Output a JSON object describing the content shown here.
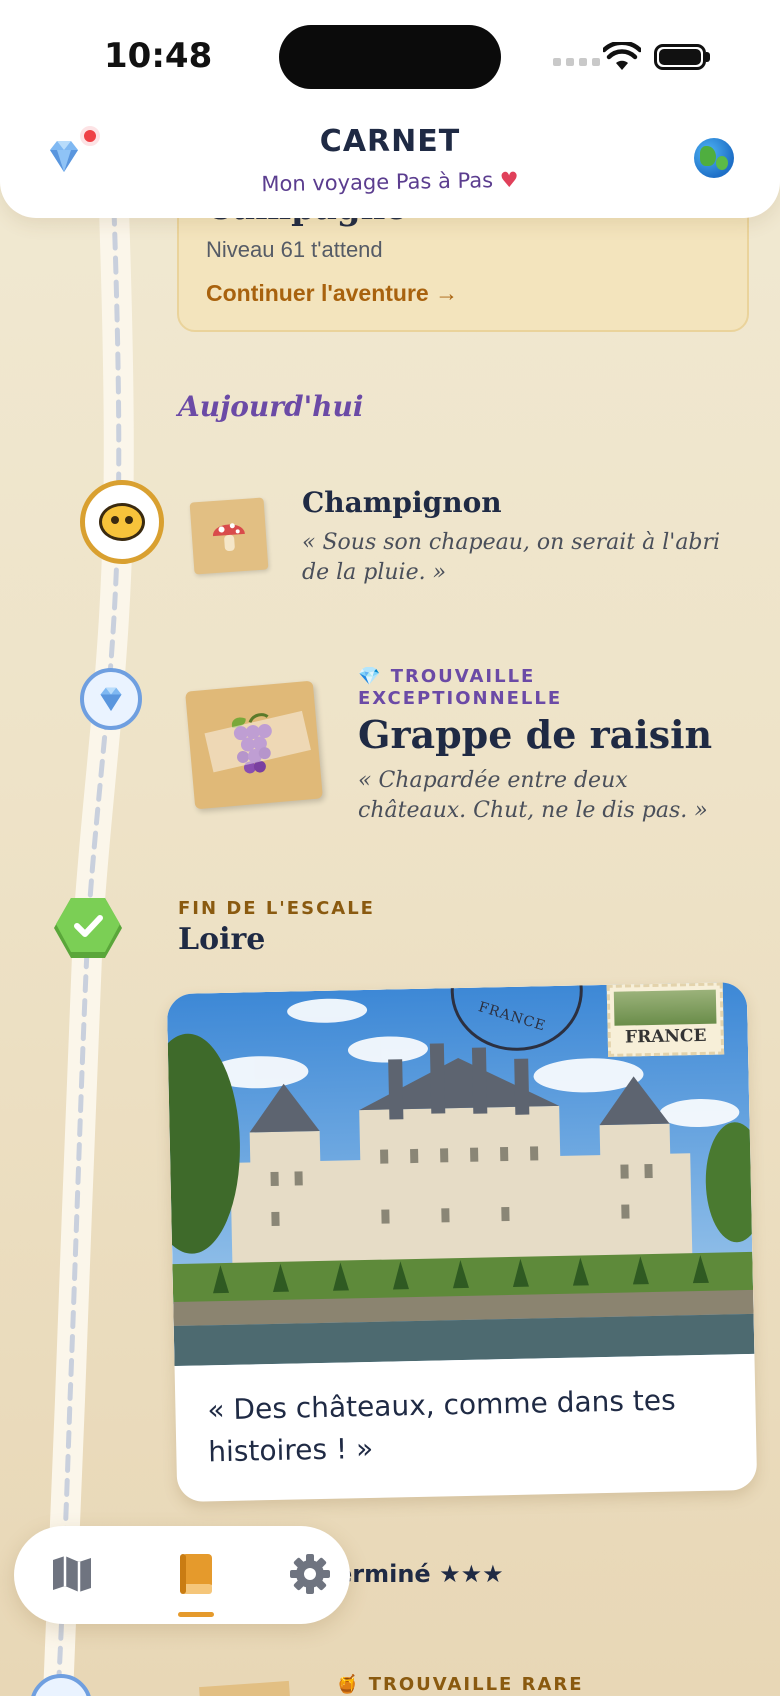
{
  "status_bar": {
    "time": "10:48"
  },
  "header": {
    "title": "CARNET",
    "subtitle": "Mon voyage Pas à Pas",
    "subtitle_heart": "♥",
    "left_icon": "gem-icon",
    "right_icon": "globe-icon"
  },
  "campaign": {
    "title": "Campagne",
    "level": "Niveau 61 t'attend",
    "cta": "Continuer l'aventure →"
  },
  "section": {
    "today": "Aujourd'hui"
  },
  "finds": [
    {
      "icon": "mushroom-icon",
      "name": "Champignon",
      "quote": "« Sous son chapeau, on serait à l'abri de la pluie. »"
    },
    {
      "label_icon": "💎",
      "label": "TROUVAILLE EXCEPTIONNELLE",
      "icon": "grapes-icon",
      "name": "Grappe de raisin",
      "quote": "« Chapardée entre deux châteaux. Chut, ne le dis pas. »"
    }
  ],
  "stop": {
    "label": "FIN DE L'ESCALE",
    "name": "Loire",
    "postcard": {
      "stamp_text": "FRANCE",
      "postmark_text": "FRANCE",
      "quote": "« Des châteaux, comme dans tes histoires ! »"
    }
  },
  "completed": {
    "text": "erminé ★★★"
  },
  "next_find": {
    "label_icon": "🍯",
    "label": "TROUVAILLE RARE"
  },
  "tabbar": {
    "tabs": [
      {
        "name": "map",
        "icon": "map-icon",
        "active": false
      },
      {
        "name": "journal",
        "icon": "book-icon",
        "active": true
      },
      {
        "name": "settings",
        "icon": "gear-icon",
        "active": false
      }
    ]
  },
  "colors": {
    "accent": "#e59a2c",
    "navy": "#1f2a44",
    "purple": "#6b4aa6",
    "brown": "#8a5a10",
    "cta": "#a8620e",
    "success": "#6cc24a"
  }
}
